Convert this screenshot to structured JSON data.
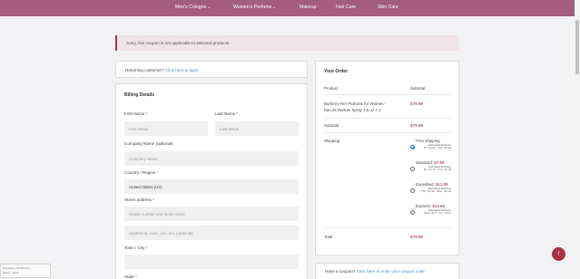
{
  "nav": {
    "items": [
      "Men's Cologne",
      "Women's Perfume",
      "Makeup",
      "Hair Care",
      "Skin Care"
    ]
  },
  "notice": {
    "text": "Sorry, this coupon is not applicable to selected products."
  },
  "returning": {
    "text": "Returning customer?",
    "link": "Click here to login"
  },
  "billing": {
    "title": "Billing Details",
    "first_name_label": "First Name",
    "first_name_placeholder": "First Name",
    "last_name_label": "Last Name",
    "last_name_placeholder": "Last Name",
    "company_label": "Company Name (optional)",
    "company_placeholder": "Company Name",
    "country_label": "Country / Region",
    "country_value": "United States (US)",
    "street_label": "Street address",
    "street_placeholder": "House number and street name",
    "apt_placeholder": "Apartment, suite, unit, etc. (optional)",
    "city_label": "Town / City",
    "state_label": "State",
    "required_mark": "*"
  },
  "order": {
    "title": "Your Order",
    "product_header": "Product",
    "subtotal_header": "Subtotal",
    "product_name_line1": "Burberry Her Perfume for Women -",
    "product_name_line2": "Eau de Parfum Spray 1.6 oz  × 1",
    "product_price": "$79.99",
    "subtotal_label": "Subtotal",
    "subtotal_value": "$79.99",
    "shipping_label": "Shipping",
    "shipping_options": [
      {
        "name": "Free shipping",
        "price": "",
        "est_line1": "Estimated Delivery",
        "est_line2": "Fri, Jul 11 - Tue, Jul 15",
        "checked": true
      },
      {
        "name": "Standard:",
        "price": "$7.99",
        "est_line1": "Estimated Delivery",
        "est_line2": "Fri, Jul 11 - Tue, Jul 15",
        "checked": false
      },
      {
        "name": "Expedited:",
        "price": "$12.99",
        "est_line1": "Estimated Delivery",
        "est_line2": "Thu, Jul 10 - Mon, Jul 14",
        "checked": false
      },
      {
        "name": "Express:",
        "price": "$14.99",
        "est_line1": "Estimated Delivery",
        "est_line2": "Wed, Jul 9 - Fri, Jul 11",
        "checked": false
      }
    ],
    "total_label": "Total",
    "total_value": "$79.99"
  },
  "coupon": {
    "text": "Have a coupon?",
    "link": "Click here to enter your coupon code"
  },
  "recaptcha": {
    "line1": "protected by reCAPTCHA",
    "line2": "Privacy - Terms"
  },
  "icons": {
    "scroll_top": "arrow-up-icon",
    "dropdown": "chevron-down-icon"
  },
  "colors": {
    "brand": "#a45d7d",
    "error": "#a8324a",
    "link": "#4b8fc7"
  }
}
